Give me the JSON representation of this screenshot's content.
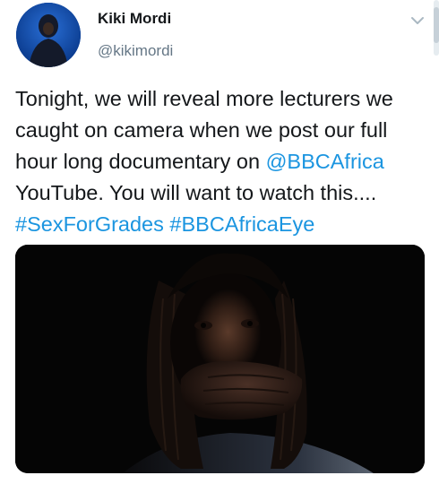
{
  "tweet": {
    "author": {
      "display_name": "Kiki Mordi",
      "handle": "@kikimordi"
    },
    "text_lines": [
      [
        {
          "text": "Tonight, we will reveal more lecturers we",
          "link": false
        }
      ],
      [
        {
          "text": "caught on camera when we post our full",
          "link": false
        }
      ],
      [
        {
          "text": "hour long documentary on ",
          "link": false
        },
        {
          "text": "@BBCAfrica",
          "link": true
        }
      ],
      [
        {
          "text": "YouTube. You will want to watch this....",
          "link": false
        }
      ],
      [
        {
          "text": "#SexForGrades",
          "link": true
        },
        {
          "text": " ",
          "link": false
        },
        {
          "text": "#BBCAfricaEye",
          "link": true
        }
      ]
    ],
    "menu_icon": "chevron-down-icon",
    "media": {
      "kind": "photo"
    }
  },
  "colors": {
    "link": "#1b95e0",
    "text": "#14171a",
    "secondary": "#657786",
    "avatar_background": "#0f4cab"
  }
}
